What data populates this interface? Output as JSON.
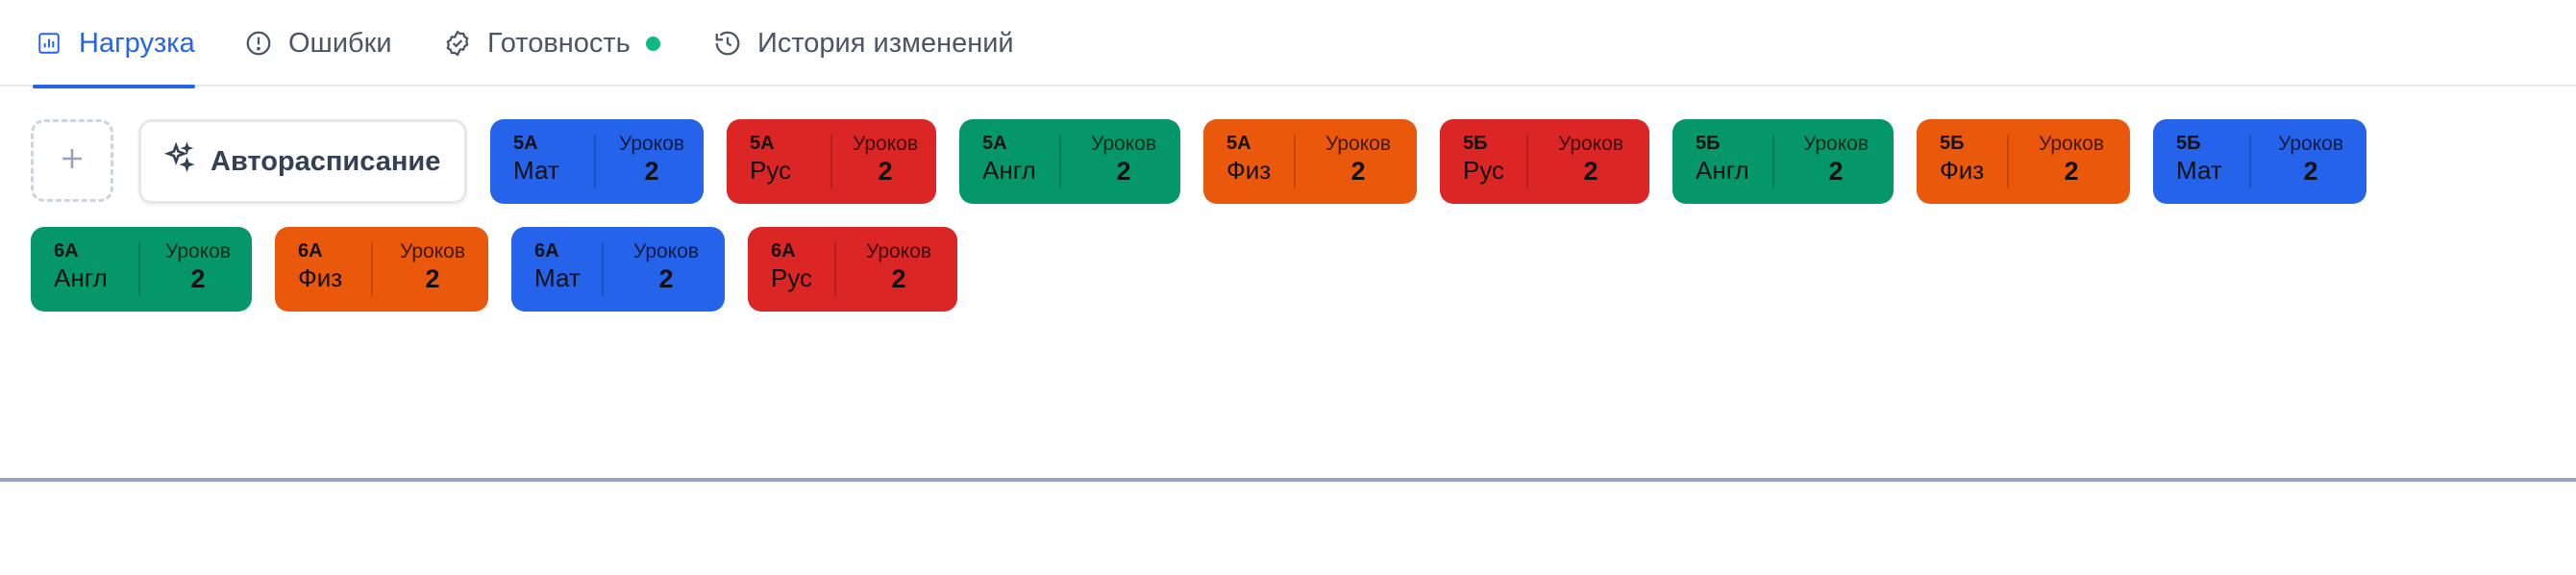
{
  "tabs": [
    {
      "label": "Нагрузка",
      "icon": "bar-chart-icon",
      "active": true
    },
    {
      "label": "Ошибки",
      "icon": "alert-circle-icon",
      "active": false
    },
    {
      "label": "Готовность",
      "icon": "badge-check-icon",
      "active": false,
      "status_color": "#10b981"
    },
    {
      "label": "История изменений",
      "icon": "history-icon",
      "active": false
    }
  ],
  "toolbar": {
    "add_icon": "plus-icon",
    "autoschedule_label": "Авторасписание",
    "autoschedule_icon": "sparkles-icon"
  },
  "colors": {
    "accent": "#2563eb",
    "blue": "#2563eb",
    "red": "#dc2626",
    "green": "#059669",
    "orange": "#ea580c"
  },
  "cards": [
    {
      "class": "5А",
      "subject": "Мат",
      "count_label": "Уроков",
      "count": "2",
      "color": "blue"
    },
    {
      "class": "5А",
      "subject": "Рус",
      "count_label": "Уроков",
      "count": "2",
      "color": "red"
    },
    {
      "class": "5А",
      "subject": "Англ",
      "count_label": "Уроков",
      "count": "2",
      "color": "green"
    },
    {
      "class": "5А",
      "subject": "Физ",
      "count_label": "Уроков",
      "count": "2",
      "color": "orange"
    },
    {
      "class": "5Б",
      "subject": "Рус",
      "count_label": "Уроков",
      "count": "2",
      "color": "red"
    },
    {
      "class": "5Б",
      "subject": "Англ",
      "count_label": "Уроков",
      "count": "2",
      "color": "green"
    },
    {
      "class": "5Б",
      "subject": "Физ",
      "count_label": "Уроков",
      "count": "2",
      "color": "orange"
    },
    {
      "class": "5Б",
      "subject": "Мат",
      "count_label": "Уроков",
      "count": "2",
      "color": "blue"
    },
    {
      "class": "6А",
      "subject": "Англ",
      "count_label": "Уроков",
      "count": "2",
      "color": "green"
    },
    {
      "class": "6А",
      "subject": "Физ",
      "count_label": "Уроков",
      "count": "2",
      "color": "orange"
    },
    {
      "class": "6А",
      "subject": "Мат",
      "count_label": "Уроков",
      "count": "2",
      "color": "blue"
    },
    {
      "class": "6А",
      "subject": "Рус",
      "count_label": "Уроков",
      "count": "2",
      "color": "red"
    }
  ]
}
